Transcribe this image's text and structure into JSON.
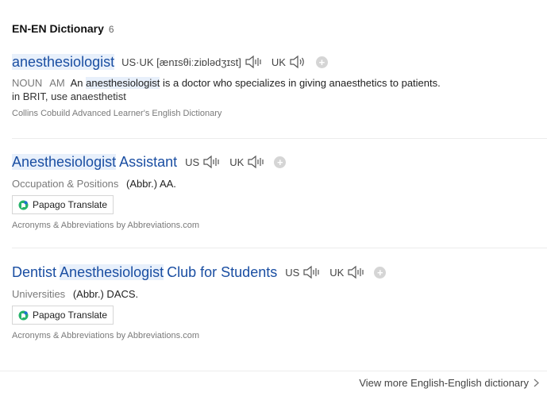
{
  "section": {
    "title": "EN-EN Dictionary",
    "count": "6"
  },
  "entries": [
    {
      "word": "anesthesiologist",
      "pronunciation": "US·UK [ænɪsθiːziɒlədʒɪst]",
      "region_uk": "UK",
      "pos": "NOUN",
      "pos_region": "AM",
      "def_before": "An",
      "def_highlight": "anesthesiologist",
      "def_after": "is a doctor who specializes in giving anaesthetics to patients.",
      "note": "in BRIT, use anaesthetist",
      "source": "Collins Cobuild Advanced Learner's English Dictionary"
    },
    {
      "word_highlight": "Anesthesiologist",
      "word_rest": "Assistant",
      "region_us": "US",
      "region_uk": "UK",
      "category": "Occupation & Positions",
      "abbr": "(Abbr.) AA.",
      "button": "Papago Translate",
      "source": "Acronyms & Abbreviations by Abbreviations.com"
    },
    {
      "word_before": "Dentist",
      "word_highlight": "Anesthesiologist",
      "word_rest": "Club for Students",
      "region_us": "US",
      "region_uk": "UK",
      "category": "Universities",
      "abbr": "(Abbr.) DACS.",
      "button": "Papago Translate",
      "source": "Acronyms & Abbreviations by Abbreviations.com"
    }
  ],
  "footer": {
    "more": "View more English-English dictionary"
  },
  "icons": {
    "speaker": "speaker-icon",
    "add": "plus-icon",
    "papago": "papago-icon",
    "chevron": "chevron-right-icon"
  },
  "colors": {
    "link": "#1a4ea2",
    "highlight": "#e8f0fb",
    "muted": "#7a7a7a"
  }
}
